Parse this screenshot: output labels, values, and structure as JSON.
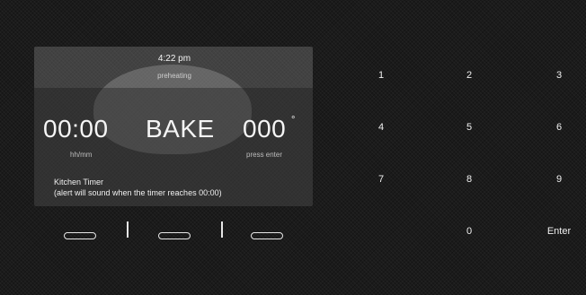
{
  "display": {
    "time": "4:22 pm",
    "status": "preheating",
    "timer_value": "00:00",
    "mode": "BAKE",
    "temperature": "000",
    "degree_symbol": "°",
    "timer_unit_label": "hh/mm",
    "temp_hint": "press enter",
    "kitchen_timer_title": "Kitchen Timer",
    "kitchen_timer_note": "(alert will sound when the timer reaches 00:00)"
  },
  "keypad": {
    "keys": [
      "1",
      "2",
      "3",
      "4",
      "5",
      "6",
      "7",
      "8",
      "9",
      "0"
    ],
    "enter": "Enter"
  }
}
